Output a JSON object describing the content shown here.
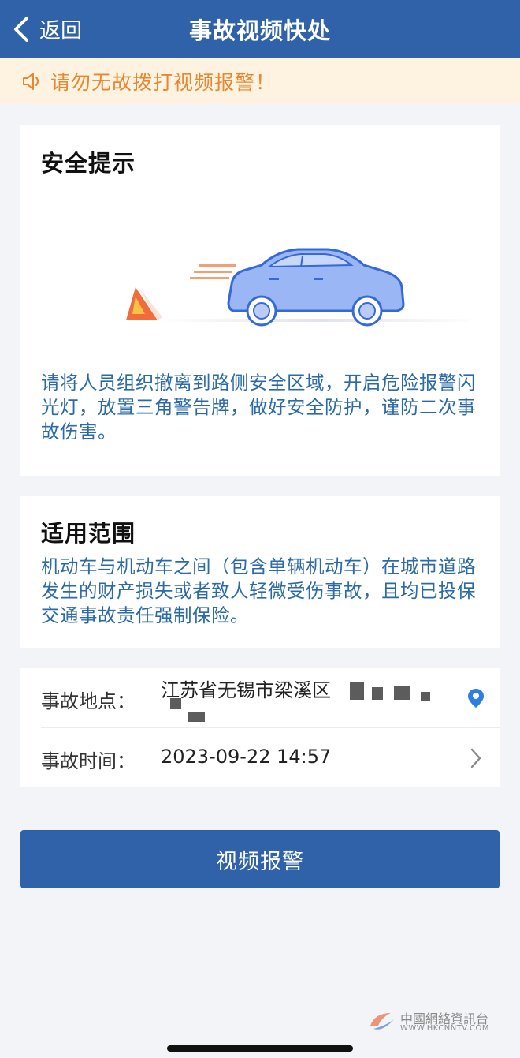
{
  "header": {
    "back_label": "返回",
    "title": "事故视频快处"
  },
  "notice": {
    "text": "请勿无故拨打视频报警！",
    "icon": "speaker-icon"
  },
  "safety": {
    "title": "安全提示",
    "description": "请将人员组织撤离到路侧安全区域，开启危险报警闪光灯，放置三角警告牌，做好安全防护，谨防二次事故伤害。"
  },
  "scope": {
    "title": "适用范围",
    "description": "机动车与机动车之间（包含单辆机动车）在城市道路发生的财产损失或者致人轻微受伤事故，且均已投保交通事故责任强制保险。"
  },
  "form": {
    "location_label": "事故地点：",
    "location_value": "江苏省无锡市梁溪区",
    "time_label": "事故时间：",
    "time_value": "2023-09-22 14:57"
  },
  "submit_label": "视频报警",
  "watermark": {
    "cn": "中國網絡資訊台",
    "en": "WWW.HKCNNTV.COM"
  },
  "colors": {
    "primary": "#2f62a8",
    "notice_text": "#e9862f",
    "notice_bg": "#fdf3e0",
    "desc_text": "#2b6aa8"
  }
}
